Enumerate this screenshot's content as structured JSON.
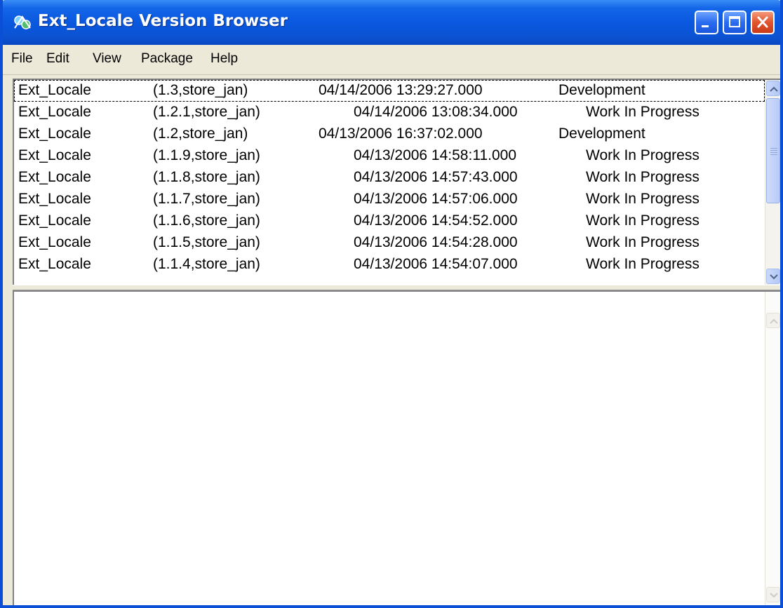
{
  "window": {
    "title": "Ext_Locale Version Browser",
    "icon": "app-network-icon",
    "controls": [
      "minimize-icon",
      "maximize-icon",
      "close-icon"
    ],
    "colors": {
      "titlebar": "#0a58df",
      "close": "#e0542e",
      "face": "#ece9d8"
    }
  },
  "menu": [
    {
      "label": "File"
    },
    {
      "label": "Edit"
    },
    {
      "label": "View"
    },
    {
      "label": "Package"
    },
    {
      "label": "Help"
    }
  ],
  "versions": [
    {
      "name": "Ext_Locale",
      "version": "(1.3,store_jan)",
      "timestamp": "04/14/2006 13:29:27.000",
      "state": "Development"
    },
    {
      "name": "Ext_Locale",
      "version": "(1.2.1,store_jan)",
      "timestamp": "04/14/2006 13:08:34.000",
      "state": "Work In Progress"
    },
    {
      "name": "Ext_Locale",
      "version": "(1.2,store_jan)",
      "timestamp": "04/13/2006 16:37:02.000",
      "state": "Development"
    },
    {
      "name": "Ext_Locale",
      "version": "(1.1.9,store_jan)",
      "timestamp": "04/13/2006 14:58:11.000",
      "state": "Work In Progress"
    },
    {
      "name": "Ext_Locale",
      "version": "(1.1.8,store_jan)",
      "timestamp": "04/13/2006 14:57:43.000",
      "state": "Work In Progress"
    },
    {
      "name": "Ext_Locale",
      "version": "(1.1.7,store_jan)",
      "timestamp": "04/13/2006 14:57:06.000",
      "state": "Work In Progress"
    },
    {
      "name": "Ext_Locale",
      "version": "(1.1.6,store_jan)",
      "timestamp": "04/13/2006 14:54:52.000",
      "state": "Work In Progress"
    },
    {
      "name": "Ext_Locale",
      "version": "(1.1.5,store_jan)",
      "timestamp": "04/13/2006 14:54:28.000",
      "state": "Work In Progress"
    },
    {
      "name": "Ext_Locale",
      "version": "(1.1.4,store_jan)",
      "timestamp": "04/13/2006 14:54:07.000",
      "state": "Work In Progress"
    }
  ],
  "focused_row": 0
}
